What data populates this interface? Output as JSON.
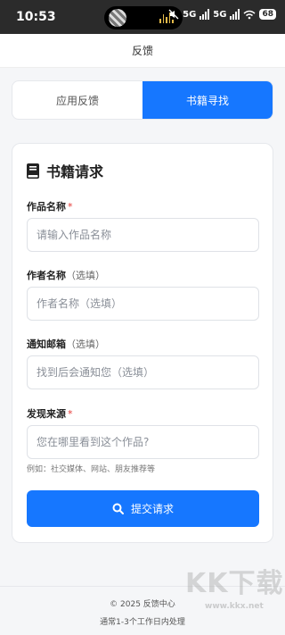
{
  "status_bar": {
    "time": "10:53",
    "network1": "5G",
    "network2": "5G",
    "battery": "68"
  },
  "header": {
    "title": "反馈"
  },
  "tabs": [
    {
      "label": "应用反馈",
      "active": false
    },
    {
      "label": "书籍寻找",
      "active": true
    }
  ],
  "form": {
    "title": "书籍请求",
    "fields": {
      "work_name": {
        "label": "作品名称",
        "required_mark": "*",
        "placeholder": "请输入作品名称",
        "value": ""
      },
      "author_name": {
        "label": "作者名称",
        "hint": "（选填）",
        "placeholder": "作者名称（选填）",
        "value": ""
      },
      "email": {
        "label": "通知邮箱",
        "hint": "（选填）",
        "placeholder": "找到后会通知您（选填）",
        "value": ""
      },
      "source": {
        "label": "发现来源",
        "required_mark": "*",
        "placeholder": "您在哪里看到这个作品?",
        "value": ""
      }
    },
    "source_helper": "例如：社交媒体、网站、朋友推荐等",
    "submit_label": "提交请求"
  },
  "footer": {
    "copyright": "© 2025 反馈中心",
    "note": "通常1-3个工作日内处理"
  },
  "watermark": {
    "text": "KK下载",
    "url": "www.kkx.net"
  },
  "colors": {
    "primary": "#1677ff",
    "required": "#e53935"
  }
}
